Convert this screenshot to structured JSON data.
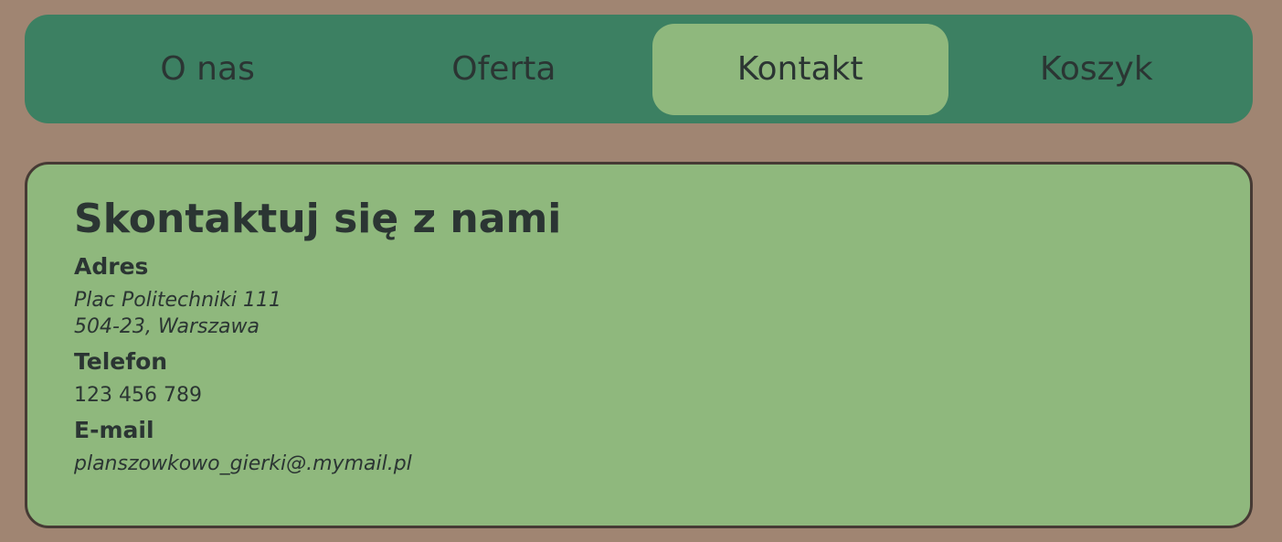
{
  "nav": {
    "items": [
      {
        "label": "O nas"
      },
      {
        "label": "Oferta"
      },
      {
        "label": "Kontakt"
      },
      {
        "label": "Koszyk"
      }
    ],
    "active": "Kontakt"
  },
  "contact": {
    "title": "Skontaktuj się z nami",
    "address_label": "Adres",
    "address_line1": "Plac Politechniki 111",
    "address_line2": "504-23, Warszawa",
    "phone_label": "Telefon",
    "phone": "123 456 789",
    "email_label": "E-mail",
    "email": "planszowkowo_gierki@.mymail.pl"
  },
  "colors": {
    "page_background": "#a08572",
    "nav_background": "#3c8062",
    "active_tab": "#8fb87d",
    "panel_background": "#8fb87d",
    "panel_border": "#463a34",
    "text": "#2b3533"
  }
}
